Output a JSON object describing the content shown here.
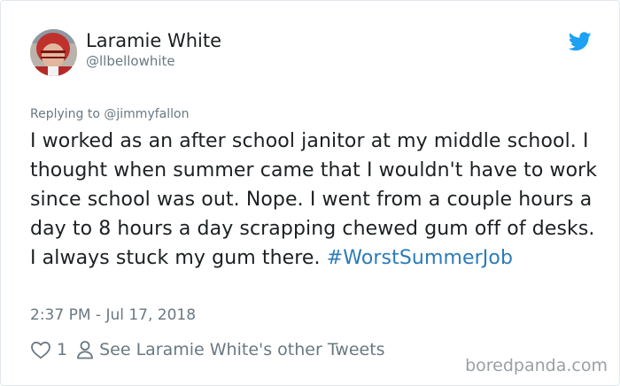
{
  "author": {
    "display_name": "Laramie White",
    "handle": "@llbellowhite",
    "avatar_icon": "user-avatar-photo"
  },
  "reply": {
    "prefix": "Replying to ",
    "mention": "@jimmyfallon"
  },
  "tweet": {
    "text": "I worked as an after school janitor at my middle school. I thought when summer came that I wouldn't have to work since school was out. Nope. I went from a couple hours a day to 8 hours a day scrapping chewed gum off of desks. I always stuck my gum there. ",
    "hashtag": "#WorstSummerJob",
    "timestamp": "2:37 PM - Jul 17, 2018"
  },
  "actions": {
    "like_count": "1",
    "other_tweets_label": "See Laramie White's other Tweets",
    "heart_icon": "heart-icon",
    "person_icon": "person-icon"
  },
  "watermark": "boredpanda.com",
  "colors": {
    "hashtag": "#2b7bb9",
    "twitter_blue": "#1da1f2",
    "muted_text": "#697882",
    "main_text": "#1c2022"
  }
}
